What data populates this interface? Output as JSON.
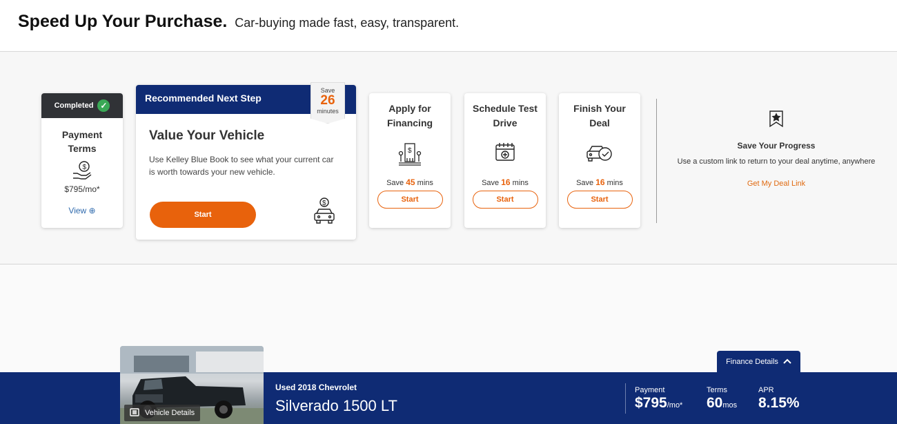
{
  "header": {
    "title": "Speed Up Your Purchase.",
    "subtitle": "Car-buying made fast, easy, transparent."
  },
  "completed_step": {
    "badge": "Completed",
    "title": "Payment Terms",
    "amount": "$795/mo*",
    "view_label": "View ⊕"
  },
  "recommended": {
    "header": "Recommended Next Step",
    "save_prefix": "Save",
    "save_value": "26",
    "save_unit": "minutes",
    "title": "Value Your Vehicle",
    "description": "Use Kelley Blue Book to see what your current car is worth towards your new vehicle.",
    "button": "Start"
  },
  "steps": [
    {
      "title": "Apply for Financing",
      "save_prefix": "Save",
      "save_value": "45",
      "save_unit": "mins",
      "button": "Start",
      "icon": "bank-icon"
    },
    {
      "title": "Schedule Test Drive",
      "save_prefix": "Save",
      "save_value": "16",
      "save_unit": "mins",
      "button": "Start",
      "icon": "calendar-icon"
    },
    {
      "title": "Finish Your Deal",
      "save_prefix": "Save",
      "save_value": "16",
      "save_unit": "mins",
      "button": "Start",
      "icon": "car-check-icon"
    }
  ],
  "progress": {
    "title": "Save Your Progress",
    "description": "Use a custom link to return to your deal anytime, anywhere",
    "link": "Get My Deal Link"
  },
  "vehicle": {
    "details_button": "Vehicle Details",
    "condition": "Used 2018 Chevrolet",
    "name": "Silverado 1500 LT"
  },
  "finance": {
    "tab_label": "Finance Details",
    "payment_label": "Payment",
    "payment_value": "$795",
    "payment_unit": "/mo*",
    "terms_label": "Terms",
    "terms_value": "60",
    "terms_unit": "mos",
    "apr_label": "APR",
    "apr_value": "8.15%"
  },
  "colors": {
    "navy": "#0f2b74",
    "orange": "#e8620c",
    "success": "#3aa856"
  }
}
